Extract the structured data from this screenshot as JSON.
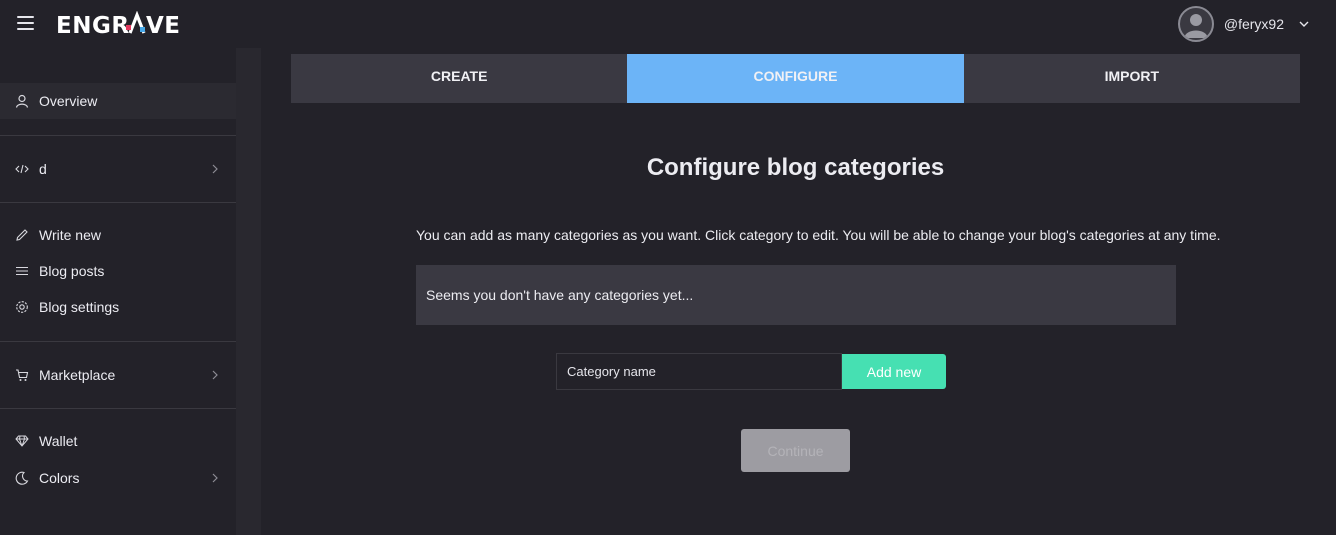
{
  "app": {
    "logo_text": "ENGRAVE",
    "colors": {
      "background": "#232229",
      "tab_inactive": "#3a3942",
      "tab_active": "#6cb4f7",
      "accent_green": "#46e0b2",
      "logo_accent_pink": "#e2395f",
      "logo_accent_blue": "#47a8e8",
      "disabled_button": "#9d9ca2"
    }
  },
  "header": {
    "menu_icon": "hamburger-icon",
    "username": "@feryx92",
    "avatar_icon": "user-avatar-icon",
    "dropdown_icon": "chevron-down-icon"
  },
  "sidebar": {
    "items": [
      {
        "label": "Overview",
        "icon": "user-icon",
        "active": true
      },
      {
        "label": "d",
        "icon": "code-icon",
        "has_submenu": true
      },
      {
        "label": "Write new",
        "icon": "pencil-icon"
      },
      {
        "label": "Blog posts",
        "icon": "list-icon"
      },
      {
        "label": "Blog settings",
        "icon": "gear-icon"
      },
      {
        "label": "Marketplace",
        "icon": "cart-icon",
        "has_submenu": true
      },
      {
        "label": "Wallet",
        "icon": "diamond-icon"
      },
      {
        "label": "Colors",
        "icon": "moon-icon",
        "has_submenu": true
      }
    ]
  },
  "tabs": [
    {
      "label": "CREATE",
      "active": false
    },
    {
      "label": "CONFIGURE",
      "active": true
    },
    {
      "label": "IMPORT",
      "active": false
    }
  ],
  "main": {
    "title": "Configure blog categories",
    "description": "You can add as many categories as you want. Click category to edit. You will be able to change your blog's categories at any time.",
    "empty_message": "Seems you don't have any categories yet...",
    "category_input": {
      "value": "",
      "placeholder": "Category name"
    },
    "add_button_label": "Add new",
    "continue_button_label": "Continue"
  }
}
